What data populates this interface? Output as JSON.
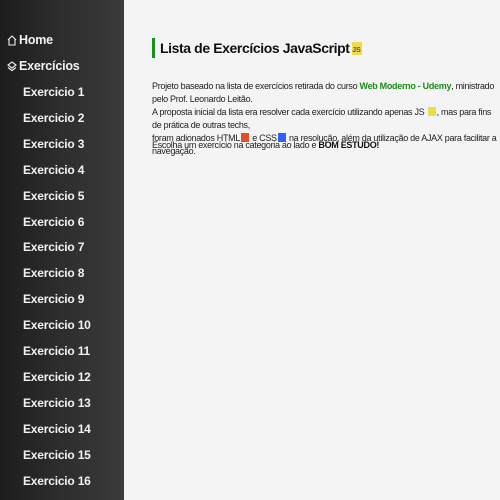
{
  "sidebar": {
    "home_label": "Home",
    "exercicios_label": "Exercícios",
    "items": [
      "Exercicio 1",
      "Exercicio 2",
      "Exercicio 3",
      "Exercicio 4",
      "Exercicio 5",
      "Exercicio 6",
      "Exercicio 7",
      "Exercicio 8",
      "Exercicio 9",
      "Exercicio 10",
      "Exercicio 11",
      "Exercicio 12",
      "Exercicio 13",
      "Exercicio 14",
      "Exercicio 15",
      "Exercicio 16"
    ]
  },
  "main": {
    "title": "Lista de Exercícios JavaScript",
    "badge": "JS",
    "p1_a": "Projeto baseado na lista de exercícios retirada do curso ",
    "p1_course": "Web Moderno - Udemy",
    "p1_b": ", ministrado pelo Prof. Leonardo Leitão.",
    "p2_a": "A proposta inicial da lista era resolver cada exercício utilizando apenas JS ",
    "p2_b": ", mas para fins de prática de outras techs,",
    "p3_a": "foram adionados HTML",
    "p3_b": " e CSS",
    "p3_c": " na resolução, além da utilização de AJAX para facilitar a navegação.",
    "p4_a": "Escolha um exercício na categoria ao lado e ",
    "p4_b": "BOM ESTUDO!"
  },
  "colors": {
    "accent": "#1a8f1a",
    "js": "#f0db4f",
    "html": "#e44d26",
    "css": "#2965f1"
  }
}
